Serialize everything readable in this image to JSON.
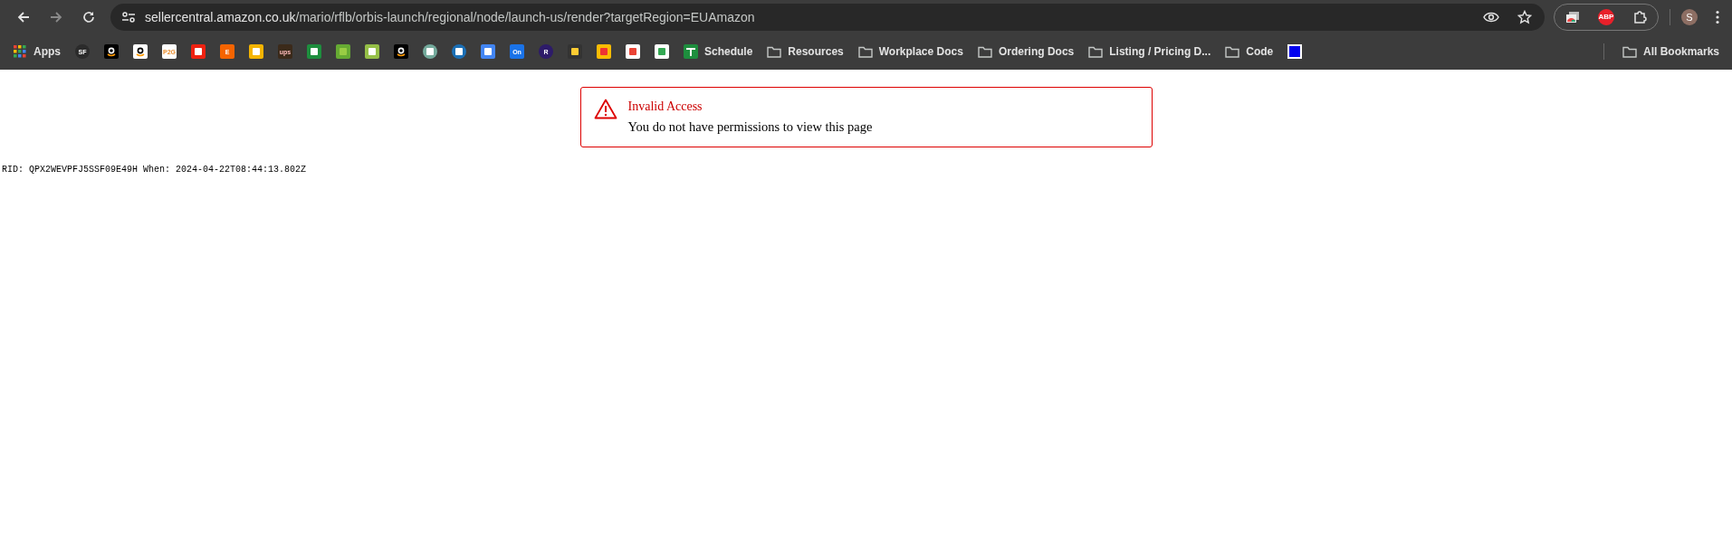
{
  "browser": {
    "url": {
      "host": "sellercentral.amazon.co.uk",
      "path": "/mario/rflb/orbis-launch/regional/node/launch-us/render?targetRegion=EUAmazon"
    },
    "extensions": [
      {
        "kind": "tabs"
      },
      {
        "kind": "badge",
        "text": "ABP"
      },
      {
        "kind": "puzzle"
      }
    ],
    "profile": {
      "initial": "S"
    },
    "bookmarks": [
      {
        "kind": "apps",
        "label": "Apps"
      },
      {
        "kind": "site",
        "text": "SF"
      },
      {
        "kind": "site"
      },
      {
        "kind": "site"
      },
      {
        "kind": "site",
        "text": "P2G"
      },
      {
        "kind": "site"
      },
      {
        "kind": "site",
        "text": "E"
      },
      {
        "kind": "site"
      },
      {
        "kind": "site",
        "text": "ups"
      },
      {
        "kind": "site"
      },
      {
        "kind": "site"
      },
      {
        "kind": "site"
      },
      {
        "kind": "site"
      },
      {
        "kind": "site"
      },
      {
        "kind": "site"
      },
      {
        "kind": "site"
      },
      {
        "kind": "site",
        "text": "On"
      },
      {
        "kind": "site",
        "text": "R"
      },
      {
        "kind": "site"
      },
      {
        "kind": "site"
      },
      {
        "kind": "site"
      },
      {
        "kind": "site"
      },
      {
        "kind": "sheet",
        "label": "Schedule"
      },
      {
        "kind": "folder",
        "label": "Resources"
      },
      {
        "kind": "folder",
        "label": "Workplace Docs"
      },
      {
        "kind": "folder",
        "label": "Ordering Docs"
      },
      {
        "kind": "folder",
        "label": "Listing / Pricing D..."
      },
      {
        "kind": "folder",
        "label": "Code"
      },
      {
        "kind": "square"
      }
    ],
    "all_bookmarks": "All Bookmarks"
  },
  "alert": {
    "title": "Invalid Access",
    "message": "You do not have permissions to view this page"
  },
  "request_info": "RID: QPX2WEVPFJ5SSF09E49H When: 2024-04-22T08:44:13.802Z"
}
